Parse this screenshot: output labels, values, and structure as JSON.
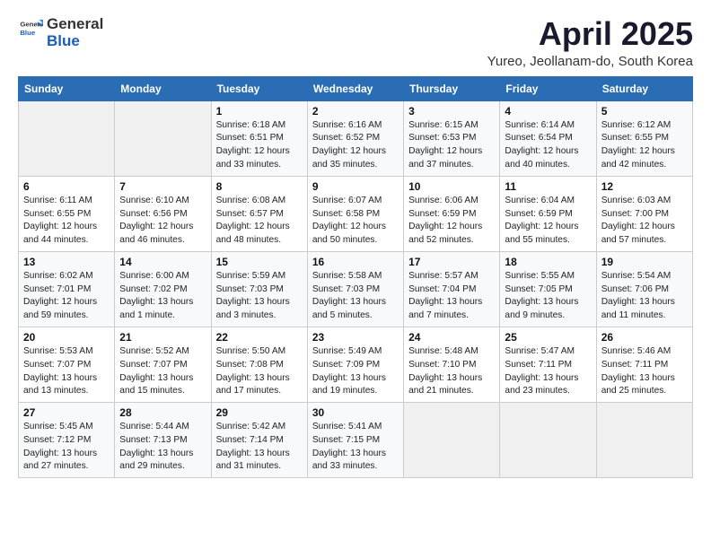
{
  "logo": {
    "general": "General",
    "blue": "Blue"
  },
  "title": "April 2025",
  "subtitle": "Yureo, Jeollanam-do, South Korea",
  "days_of_week": [
    "Sunday",
    "Monday",
    "Tuesday",
    "Wednesday",
    "Thursday",
    "Friday",
    "Saturday"
  ],
  "weeks": [
    [
      {
        "day": "",
        "info": ""
      },
      {
        "day": "",
        "info": ""
      },
      {
        "day": "1",
        "info": "Sunrise: 6:18 AM\nSunset: 6:51 PM\nDaylight: 12 hours\nand 33 minutes."
      },
      {
        "day": "2",
        "info": "Sunrise: 6:16 AM\nSunset: 6:52 PM\nDaylight: 12 hours\nand 35 minutes."
      },
      {
        "day": "3",
        "info": "Sunrise: 6:15 AM\nSunset: 6:53 PM\nDaylight: 12 hours\nand 37 minutes."
      },
      {
        "day": "4",
        "info": "Sunrise: 6:14 AM\nSunset: 6:54 PM\nDaylight: 12 hours\nand 40 minutes."
      },
      {
        "day": "5",
        "info": "Sunrise: 6:12 AM\nSunset: 6:55 PM\nDaylight: 12 hours\nand 42 minutes."
      }
    ],
    [
      {
        "day": "6",
        "info": "Sunrise: 6:11 AM\nSunset: 6:55 PM\nDaylight: 12 hours\nand 44 minutes."
      },
      {
        "day": "7",
        "info": "Sunrise: 6:10 AM\nSunset: 6:56 PM\nDaylight: 12 hours\nand 46 minutes."
      },
      {
        "day": "8",
        "info": "Sunrise: 6:08 AM\nSunset: 6:57 PM\nDaylight: 12 hours\nand 48 minutes."
      },
      {
        "day": "9",
        "info": "Sunrise: 6:07 AM\nSunset: 6:58 PM\nDaylight: 12 hours\nand 50 minutes."
      },
      {
        "day": "10",
        "info": "Sunrise: 6:06 AM\nSunset: 6:59 PM\nDaylight: 12 hours\nand 52 minutes."
      },
      {
        "day": "11",
        "info": "Sunrise: 6:04 AM\nSunset: 6:59 PM\nDaylight: 12 hours\nand 55 minutes."
      },
      {
        "day": "12",
        "info": "Sunrise: 6:03 AM\nSunset: 7:00 PM\nDaylight: 12 hours\nand 57 minutes."
      }
    ],
    [
      {
        "day": "13",
        "info": "Sunrise: 6:02 AM\nSunset: 7:01 PM\nDaylight: 12 hours\nand 59 minutes."
      },
      {
        "day": "14",
        "info": "Sunrise: 6:00 AM\nSunset: 7:02 PM\nDaylight: 13 hours\nand 1 minute."
      },
      {
        "day": "15",
        "info": "Sunrise: 5:59 AM\nSunset: 7:03 PM\nDaylight: 13 hours\nand 3 minutes."
      },
      {
        "day": "16",
        "info": "Sunrise: 5:58 AM\nSunset: 7:03 PM\nDaylight: 13 hours\nand 5 minutes."
      },
      {
        "day": "17",
        "info": "Sunrise: 5:57 AM\nSunset: 7:04 PM\nDaylight: 13 hours\nand 7 minutes."
      },
      {
        "day": "18",
        "info": "Sunrise: 5:55 AM\nSunset: 7:05 PM\nDaylight: 13 hours\nand 9 minutes."
      },
      {
        "day": "19",
        "info": "Sunrise: 5:54 AM\nSunset: 7:06 PM\nDaylight: 13 hours\nand 11 minutes."
      }
    ],
    [
      {
        "day": "20",
        "info": "Sunrise: 5:53 AM\nSunset: 7:07 PM\nDaylight: 13 hours\nand 13 minutes."
      },
      {
        "day": "21",
        "info": "Sunrise: 5:52 AM\nSunset: 7:07 PM\nDaylight: 13 hours\nand 15 minutes."
      },
      {
        "day": "22",
        "info": "Sunrise: 5:50 AM\nSunset: 7:08 PM\nDaylight: 13 hours\nand 17 minutes."
      },
      {
        "day": "23",
        "info": "Sunrise: 5:49 AM\nSunset: 7:09 PM\nDaylight: 13 hours\nand 19 minutes."
      },
      {
        "day": "24",
        "info": "Sunrise: 5:48 AM\nSunset: 7:10 PM\nDaylight: 13 hours\nand 21 minutes."
      },
      {
        "day": "25",
        "info": "Sunrise: 5:47 AM\nSunset: 7:11 PM\nDaylight: 13 hours\nand 23 minutes."
      },
      {
        "day": "26",
        "info": "Sunrise: 5:46 AM\nSunset: 7:11 PM\nDaylight: 13 hours\nand 25 minutes."
      }
    ],
    [
      {
        "day": "27",
        "info": "Sunrise: 5:45 AM\nSunset: 7:12 PM\nDaylight: 13 hours\nand 27 minutes."
      },
      {
        "day": "28",
        "info": "Sunrise: 5:44 AM\nSunset: 7:13 PM\nDaylight: 13 hours\nand 29 minutes."
      },
      {
        "day": "29",
        "info": "Sunrise: 5:42 AM\nSunset: 7:14 PM\nDaylight: 13 hours\nand 31 minutes."
      },
      {
        "day": "30",
        "info": "Sunrise: 5:41 AM\nSunset: 7:15 PM\nDaylight: 13 hours\nand 33 minutes."
      },
      {
        "day": "",
        "info": ""
      },
      {
        "day": "",
        "info": ""
      },
      {
        "day": "",
        "info": ""
      }
    ]
  ]
}
